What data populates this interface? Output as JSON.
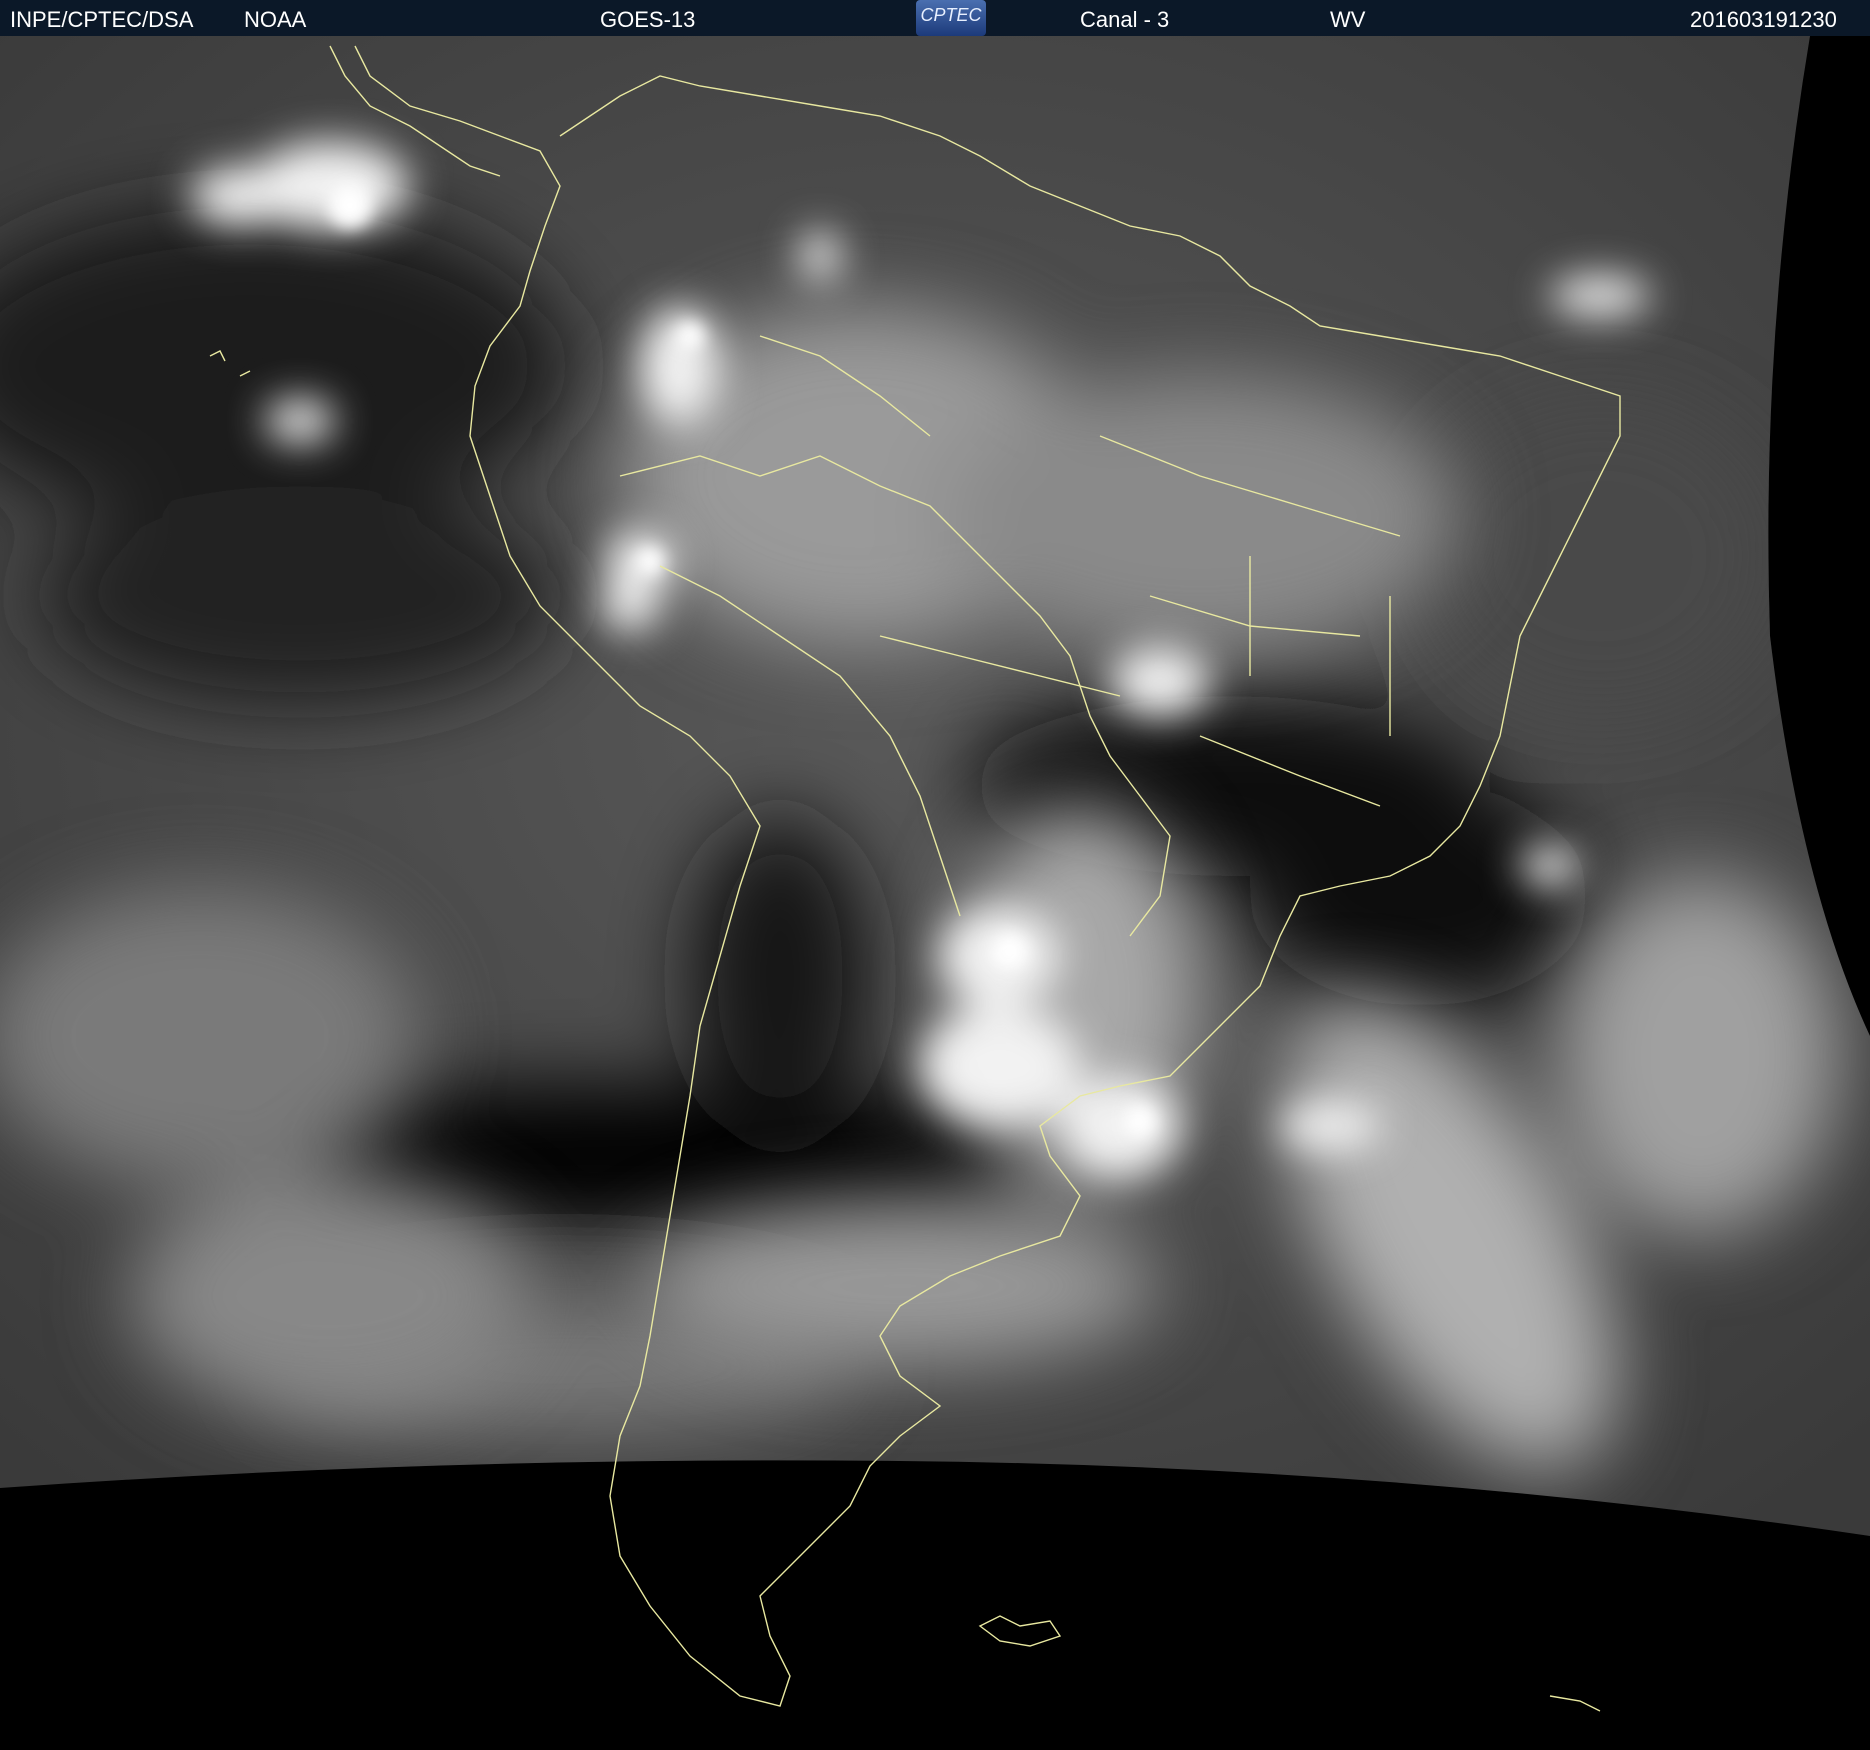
{
  "header": {
    "source": "INPE/CPTEC/DSA",
    "agency": "NOAA",
    "satellite": "GOES-13",
    "logo_text": "CPTEC",
    "channel": "Canal - 3",
    "band": "WV",
    "timestamp": "201603191230"
  },
  "imagery": {
    "type": "water-vapor satellite image",
    "region": "South America",
    "colormap": "grayscale",
    "border_color": "#e8e8a0"
  }
}
